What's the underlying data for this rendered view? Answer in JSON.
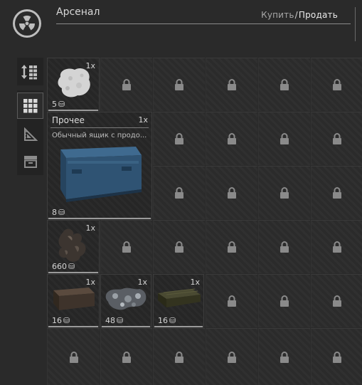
{
  "header": {
    "title": "Арсенал",
    "buy_label": "Купить",
    "separator": "/",
    "sell_label": "Продать",
    "logo_icon": "radiation-icon"
  },
  "toolbar": {
    "items": [
      {
        "icon": "sort-icon"
      },
      {
        "icon": "grid-icon",
        "active": true
      },
      {
        "icon": "ruler-triangle-icon"
      },
      {
        "icon": "crate-icon"
      }
    ]
  },
  "items": {
    "stone": {
      "qty": "1x",
      "count": "5",
      "icon": "stone-icon"
    },
    "crate": {
      "qty": "1x",
      "count": "8",
      "category": "Прочее",
      "description": "Обычный ящик с продо...",
      "icon": "blue-crate-icon"
    },
    "ore": {
      "qty": "1x",
      "count": "660",
      "icon": "ore-icon"
    },
    "box": {
      "qty": "1x",
      "count": "16",
      "icon": "brown-box-icon"
    },
    "scrap": {
      "qty": "1x",
      "count": "48",
      "icon": "scrap-metal-icon"
    },
    "pallet": {
      "qty": "1x",
      "count": "16",
      "icon": "pallet-icon"
    }
  },
  "colors": {
    "background": "#2a2a2a",
    "cell": "#2b2b2b",
    "text": "#d6d6d6"
  }
}
